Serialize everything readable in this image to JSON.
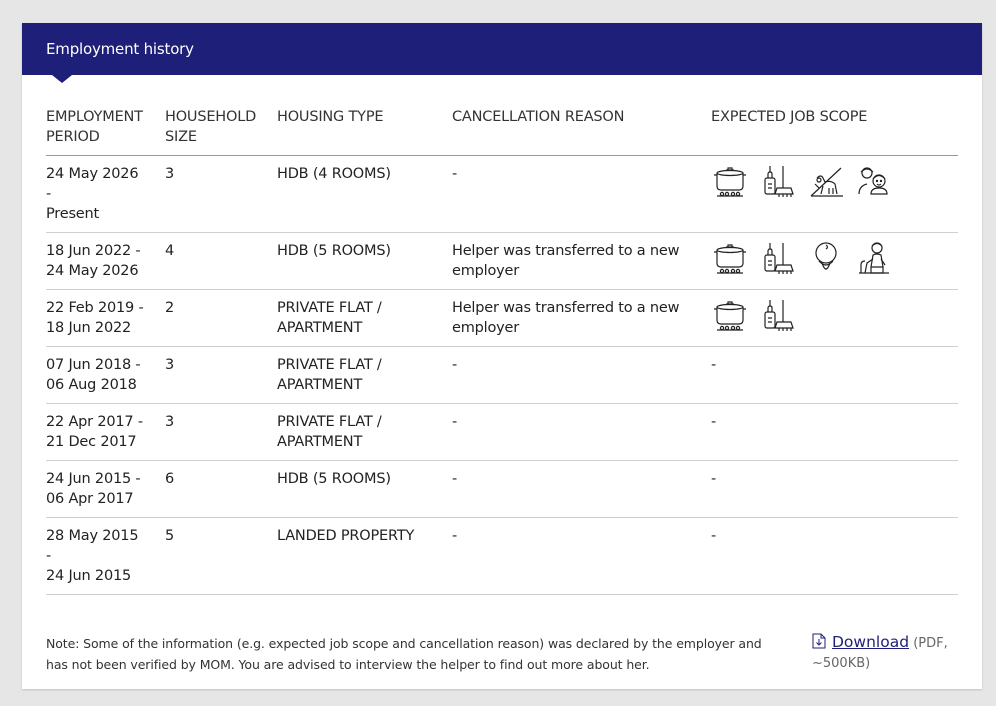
{
  "card": {
    "title": "Employment history"
  },
  "table": {
    "headers": {
      "period": "EMPLOYMENT PERIOD",
      "household_size": "HOUSEHOLD SIZE",
      "housing_type": "HOUSING TYPE",
      "cancellation_reason": "CANCELLATION REASON",
      "job_scope": "EXPECTED JOB SCOPE"
    },
    "rows": [
      {
        "period_start": "24 May 2026",
        "period_sep": "-",
        "period_end": "Present",
        "household_size": "3",
        "housing_type": "HDB (4 ROOMS)",
        "cancellation_reason": "-",
        "job_scope_icons": [
          "cooking-pot-icon",
          "cleaning-icon",
          "pet-care-icon",
          "child-care-icon"
        ]
      },
      {
        "period_start": "18 Jun 2022 -",
        "period_sep": "",
        "period_end": "24 May 2026",
        "household_size": "4",
        "housing_type": "HDB (5 ROOMS)",
        "cancellation_reason": "Helper was transferred to a new employer",
        "job_scope_icons": [
          "cooking-pot-icon",
          "cleaning-icon",
          "infant-care-icon",
          "elderly-care-icon"
        ]
      },
      {
        "period_start": "22 Feb 2019 -",
        "period_sep": "",
        "period_end": "18 Jun 2022",
        "household_size": "2",
        "housing_type": "PRIVATE FLAT / APARTMENT",
        "cancellation_reason": "Helper was transferred to a new employer",
        "job_scope_icons": [
          "cooking-pot-icon",
          "cleaning-icon"
        ]
      },
      {
        "period_start": "07 Jun 2018 -",
        "period_sep": "",
        "period_end": "06 Aug 2018",
        "household_size": "3",
        "housing_type": "PRIVATE FLAT / APARTMENT",
        "cancellation_reason": "-",
        "job_scope_text": "-"
      },
      {
        "period_start": "22 Apr 2017 -",
        "period_sep": "",
        "period_end": "21 Dec 2017",
        "household_size": "3",
        "housing_type": "PRIVATE FLAT / APARTMENT",
        "cancellation_reason": "-",
        "job_scope_text": "-"
      },
      {
        "period_start": "24 Jun 2015 -",
        "period_sep": "",
        "period_end": "06 Apr 2017",
        "household_size": "6",
        "housing_type": "HDB (5 ROOMS)",
        "cancellation_reason": "-",
        "job_scope_text": "-"
      },
      {
        "period_start": "28 May 2015",
        "period_sep": "-",
        "period_end": "24 Jun 2015",
        "household_size": "5",
        "housing_type": "LANDED PROPERTY",
        "cancellation_reason": "-",
        "job_scope_text": "-"
      }
    ]
  },
  "footer": {
    "note": "Note: Some of the information (e.g. expected job scope and cancellation reason) was declared by the employer and has not been verified by MOM. You are advised to interview the helper to find out more about her.",
    "download_label": "Download",
    "download_meta": "(PDF, ~500KB)",
    "download_icon": "document-download-icon"
  },
  "colors": {
    "header_bg": "#1e1f78",
    "page_bg": "#e6e6e6",
    "link": "#1e1f78"
  }
}
